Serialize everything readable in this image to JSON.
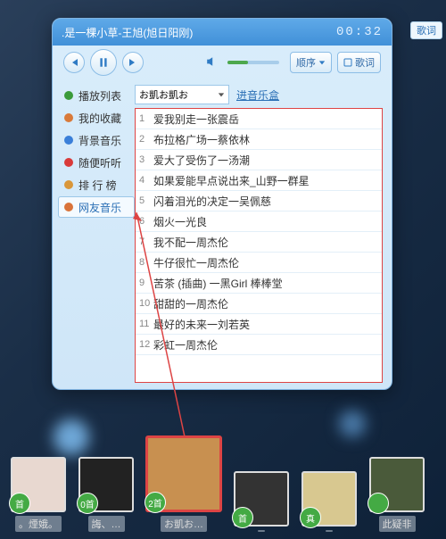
{
  "header": {
    "now_playing": ".是一棵小草-王旭(旭日阳刚)",
    "time": "00:32",
    "lyric_tag": "歌词"
  },
  "controls": {
    "mode_label": "顺序",
    "lyric_btn": "歌词"
  },
  "sidebar": {
    "items": [
      {
        "label": "播放列表",
        "icon_color": "#3a9b3a"
      },
      {
        "label": "我的收藏",
        "icon_color": "#d97a3a"
      },
      {
        "label": "背景音乐",
        "icon_color": "#3a7fd9"
      },
      {
        "label": "随便听听",
        "icon_color": "#d93a3a"
      },
      {
        "label": "排 行 榜",
        "icon_color": "#d9973a"
      },
      {
        "label": "网友音乐",
        "icon_color": "#d9733a",
        "active": true
      }
    ]
  },
  "main": {
    "dropdown_value": "お凱お凱お",
    "music_box_link": "进音乐盒",
    "songs": [
      {
        "n": "1",
        "t": "爱我别走一张震岳"
      },
      {
        "n": "2",
        "t": "布拉格广场一蔡依林"
      },
      {
        "n": "3",
        "t": "爱大了受伤了一汤潮"
      },
      {
        "n": "4",
        "t": "如果爱能早点说出来_山野一群星"
      },
      {
        "n": "5",
        "t": "闪着泪光的决定一吴佩慈"
      },
      {
        "n": "6",
        "t": "烟火一光良"
      },
      {
        "n": "7",
        "t": "我不配一周杰伦"
      },
      {
        "n": "8",
        "t": "牛仔很忙一周杰伦"
      },
      {
        "n": "9",
        "t": "苦茶 (插曲) 一黑Girl 棒棒堂"
      },
      {
        "n": "10",
        "t": "甜甜的一周杰伦"
      },
      {
        "n": "11",
        "t": "最好的未来一刘若英"
      },
      {
        "n": "12",
        "t": "彩虹一周杰伦"
      }
    ]
  },
  "dock": {
    "items": [
      {
        "label": "。煙娥。",
        "badge": "首"
      },
      {
        "label": "誨、…",
        "badge": "0首"
      },
      {
        "label": "お凱お…",
        "badge": "2首",
        "selected": true
      },
      {
        "label": "",
        "badge": "首"
      },
      {
        "label": "",
        "badge": "真"
      },
      {
        "label": "此疑非",
        "badge": ""
      }
    ]
  }
}
